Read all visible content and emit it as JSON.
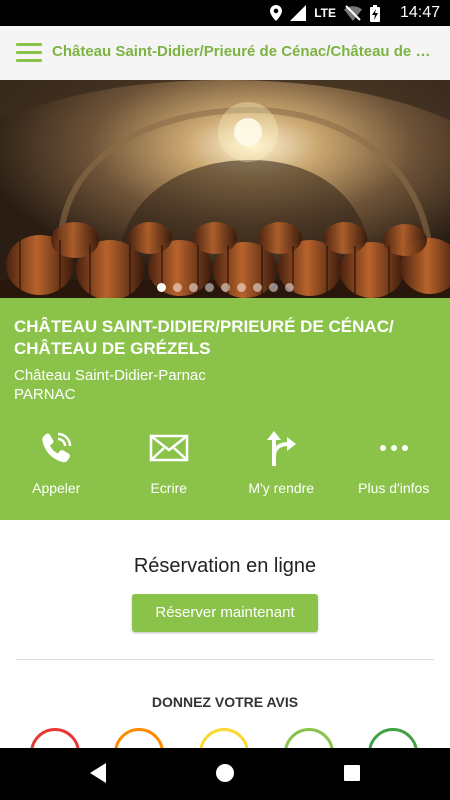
{
  "statusbar": {
    "network": "LTE",
    "time": "14:47"
  },
  "appbar": {
    "title": "Château Saint-Didier/Prieuré de Cénac/Château de Grézels"
  },
  "carousel": {
    "slide_count": 9,
    "active_index": 0
  },
  "place": {
    "title": "CHÂTEAU SAINT-DIDIER/PRIEURÉ DE CÉNAC/ CHÂTEAU DE GRÉZELS",
    "subtitle": "Château Saint-Didier-Parnac",
    "city": "PARNAC"
  },
  "actions": [
    {
      "label": "Appeler",
      "icon": "phone-icon"
    },
    {
      "label": "Ecrire",
      "icon": "mail-icon"
    },
    {
      "label": "M'y rendre",
      "icon": "directions-icon"
    },
    {
      "label": "Plus d'infos",
      "icon": "more-icon"
    }
  ],
  "reservation": {
    "title": "Réservation en ligne",
    "button": "Réserver maintenant"
  },
  "review": {
    "title": "DONNEZ VOTRE AVIS",
    "faces": [
      {
        "icon": "very-unhappy-face-icon",
        "color": "#e53935"
      },
      {
        "icon": "unhappy-face-icon",
        "color": "#fb8c00"
      },
      {
        "icon": "neutral-face-icon",
        "color": "#fdd835"
      },
      {
        "icon": "happy-face-icon",
        "color": "#8bc34a"
      },
      {
        "icon": "very-happy-face-icon",
        "color": "#43a047"
      }
    ]
  },
  "colors": {
    "accent": "#8bc34a",
    "appbar_title": "#7cb342"
  }
}
